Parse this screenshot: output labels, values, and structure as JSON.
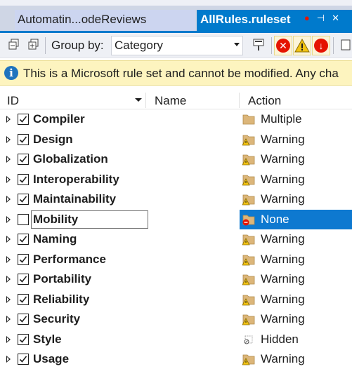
{
  "tabs": [
    {
      "label": "Automatin...odeReviews",
      "active": false
    },
    {
      "label": "AllRules.ruleset",
      "active": true
    }
  ],
  "toolbar": {
    "group_by_label": "Group by:",
    "group_by_value": "Category"
  },
  "infobar": {
    "text": "This is a Microsoft rule set and cannot be modified. Any cha"
  },
  "columns": {
    "id": "ID",
    "name": "Name",
    "action": "Action"
  },
  "rules": [
    {
      "id": "Compiler",
      "checked": true,
      "action": "Multiple",
      "icon": "folder-icon"
    },
    {
      "id": "Design",
      "checked": true,
      "action": "Warning",
      "icon": "warning-folder-icon"
    },
    {
      "id": "Globalization",
      "checked": true,
      "action": "Warning",
      "icon": "warning-folder-icon"
    },
    {
      "id": "Interoperability",
      "checked": true,
      "action": "Warning",
      "icon": "warning-folder-icon"
    },
    {
      "id": "Maintainability",
      "checked": true,
      "action": "Warning",
      "icon": "warning-folder-icon"
    },
    {
      "id": "Mobility",
      "checked": false,
      "action": "None",
      "icon": "none-folder-icon",
      "selected": true
    },
    {
      "id": "Naming",
      "checked": true,
      "action": "Warning",
      "icon": "warning-folder-icon"
    },
    {
      "id": "Performance",
      "checked": true,
      "action": "Warning",
      "icon": "warning-folder-icon"
    },
    {
      "id": "Portability",
      "checked": true,
      "action": "Warning",
      "icon": "warning-folder-icon"
    },
    {
      "id": "Reliability",
      "checked": true,
      "action": "Warning",
      "icon": "warning-folder-icon"
    },
    {
      "id": "Security",
      "checked": true,
      "action": "Warning",
      "icon": "warning-folder-icon"
    },
    {
      "id": "Style",
      "checked": true,
      "action": "Hidden",
      "icon": "hidden-icon"
    },
    {
      "id": "Usage",
      "checked": true,
      "action": "Warning",
      "icon": "warning-folder-icon"
    }
  ],
  "colors": {
    "accent": "#007acc",
    "selected_row": "#0e79d0",
    "infobar_bg": "#fdf4bf",
    "folder": "#dcb67a",
    "warning": "#f2c314",
    "error": "#e51400"
  }
}
